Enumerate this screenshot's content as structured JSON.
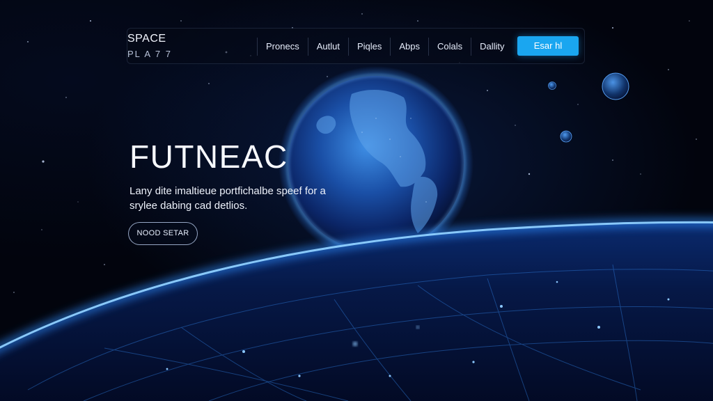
{
  "brand": {
    "line1": "SPACE",
    "line2": "PL A 7 7"
  },
  "nav": {
    "links": [
      "Pronecs",
      "Autlut",
      "Piqles",
      "Abps",
      "Colals",
      "Dallity"
    ],
    "cta_label": "Esar hl"
  },
  "hero": {
    "title": "FUTNEAC",
    "description": "Lany dite imaltieue portfichalbe speef for a srylee dabing cad detlios.",
    "button_label": "NOOD SETAR"
  },
  "colors": {
    "accent": "#1aa6f0",
    "background": "#02040d",
    "glow": "#2e8dff"
  }
}
